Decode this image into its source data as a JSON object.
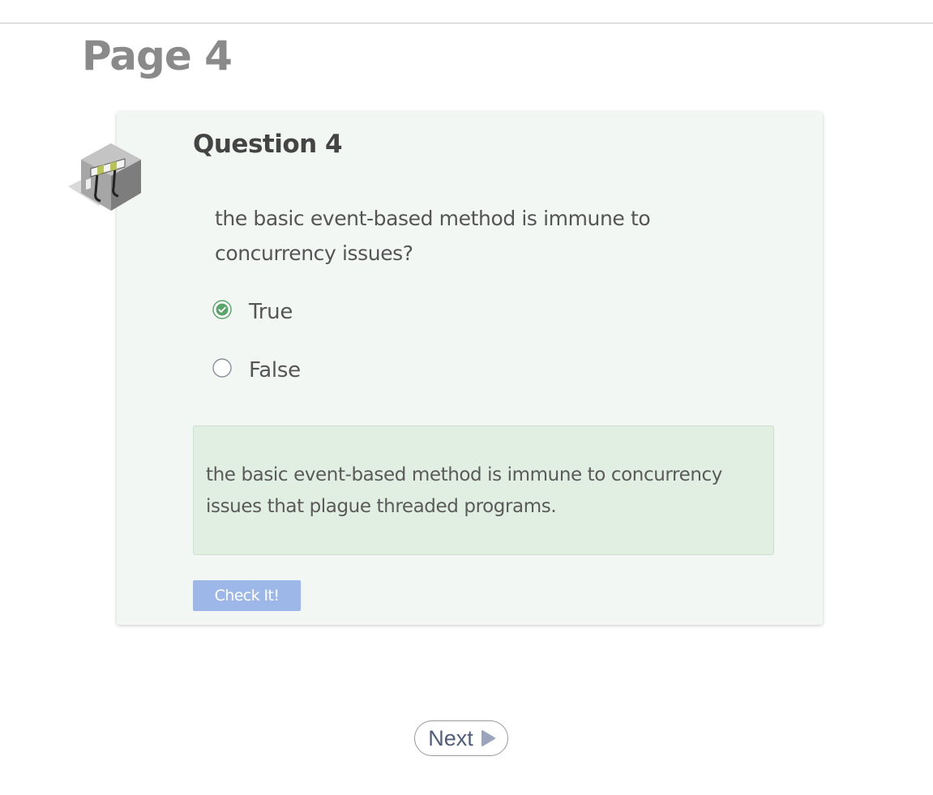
{
  "page": {
    "title": "Page 4"
  },
  "question": {
    "heading": "Question 4",
    "icon": "barrier-icon",
    "text": "the basic event-based method is immune to concurrency issues?",
    "options": [
      {
        "label": "True",
        "selected": true,
        "state": "correct"
      },
      {
        "label": "False",
        "selected": false
      }
    ],
    "feedback": "the basic event-based method is immune to concurrency issues that plague threaded programs.",
    "check_label": "Check It!"
  },
  "navigation": {
    "next_label": "Next",
    "next_icon": "play-arrow-icon"
  },
  "colors": {
    "title": "#8a8a8a",
    "card_background": "#f2f7f3",
    "feedback_background": "#e1eee2",
    "correct_green": "#5aa66a",
    "check_button": "#9db8e8",
    "next_text": "#4f5d7a"
  }
}
